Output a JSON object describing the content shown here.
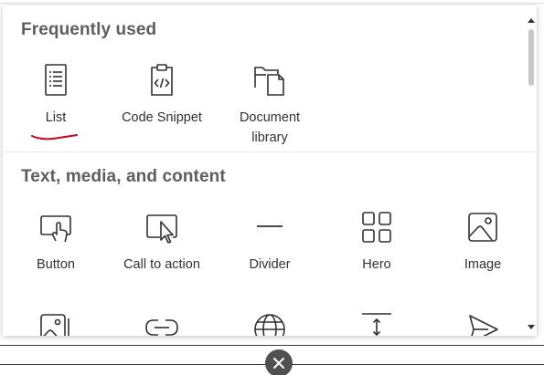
{
  "sections": {
    "frequently_used": {
      "title": "Frequently used",
      "items": [
        {
          "label": "List",
          "icon": "list-icon"
        },
        {
          "label": "Code Snippet",
          "icon": "code-snippet-icon"
        },
        {
          "label": "Document\nlibrary",
          "icon": "document-library-icon"
        }
      ]
    },
    "text_media_content": {
      "title": "Text, media, and content",
      "items": [
        {
          "label": "Button",
          "icon": "button-icon"
        },
        {
          "label": "Call to action",
          "icon": "call-to-action-icon"
        },
        {
          "label": "Divider",
          "icon": "divider-icon"
        },
        {
          "label": "Hero",
          "icon": "hero-icon"
        },
        {
          "label": "Image",
          "icon": "image-icon"
        }
      ],
      "partial_row_icons": [
        "image-gallery-icon",
        "link-icon",
        "globe-icon",
        "spacer-icon",
        "send-icon"
      ]
    }
  },
  "annotation": {
    "color": "#d0021b"
  },
  "colors": {
    "section_title": "#605e5c",
    "label": "#323130",
    "icon_stroke": "#323130",
    "close_button": "#505050"
  }
}
